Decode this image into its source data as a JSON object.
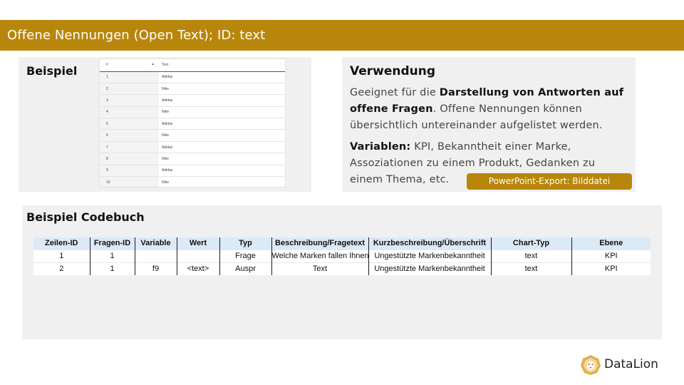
{
  "header": {
    "title": "Offene Nennungen (Open Text); ID: text"
  },
  "example": {
    "heading": "Beispiel",
    "table": {
      "col_index": "#",
      "col_text": "Text",
      "rows": [
        {
          "n": "1",
          "text": "Adidas"
        },
        {
          "n": "2",
          "text": "Nike"
        },
        {
          "n": "3",
          "text": "Adidas"
        },
        {
          "n": "4",
          "text": "Nike"
        },
        {
          "n": "5",
          "text": "Adidas"
        },
        {
          "n": "6",
          "text": "Nike"
        },
        {
          "n": "7",
          "text": "Adidas"
        },
        {
          "n": "8",
          "text": "Nike"
        },
        {
          "n": "9",
          "text": "Adidas"
        },
        {
          "n": "10",
          "text": "Nike"
        }
      ]
    }
  },
  "usage": {
    "heading": "Verwendung",
    "p1_a": "Geeignet für die ",
    "p1_b": "Darstellung von Antworten auf offene Fragen",
    "p1_c": ". Offene Nennungen können übersichtlich untereinander aufgelistet werden.",
    "p2_a": "Variablen:",
    "p2_b": " KPI, Bekanntheit einer Marke, Assoziationen zu einem Produkt, Gedanken zu einem Thema, etc.",
    "export_badge": "PowerPoint-Export: Bilddatei"
  },
  "codebook": {
    "heading": "Beispiel Codebuch",
    "headers": [
      "Zeilen-ID",
      "Fragen-ID",
      "Variable",
      "Wert",
      "Typ",
      "Beschreibung/Fragetext",
      "Kurzbeschreibung/Überschrift",
      "Chart-Typ",
      "Ebene"
    ],
    "rows": [
      [
        "1",
        "1",
        "",
        "",
        "Frage",
        "Welche Marken fallen Ihnen ein?",
        "Ungestützte Markenbekanntheit",
        "text",
        "KPI"
      ],
      [
        "2",
        "1",
        "f9",
        "<text>",
        "Auspr",
        "Text",
        "Ungestützte Markenbekanntheit",
        "text",
        "KPI"
      ]
    ]
  },
  "brand": {
    "name": "DataLion",
    "accent_color": "#b8860b",
    "icon": "lion-head-icon"
  }
}
